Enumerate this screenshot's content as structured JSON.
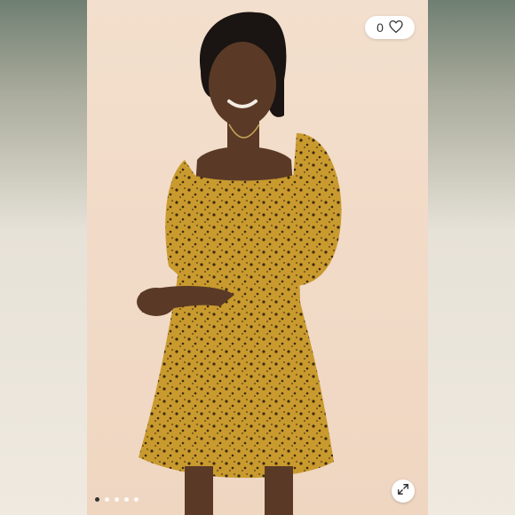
{
  "listing": {
    "like_count": "0",
    "like_icon": "heart-icon",
    "expand_icon": "expand-arrows-icon",
    "carousel_total": 5,
    "carousel_active_index": 0
  },
  "colors": {
    "dress_mustard": "#c99a2e",
    "backdrop_peach": "#f1dcc8"
  }
}
